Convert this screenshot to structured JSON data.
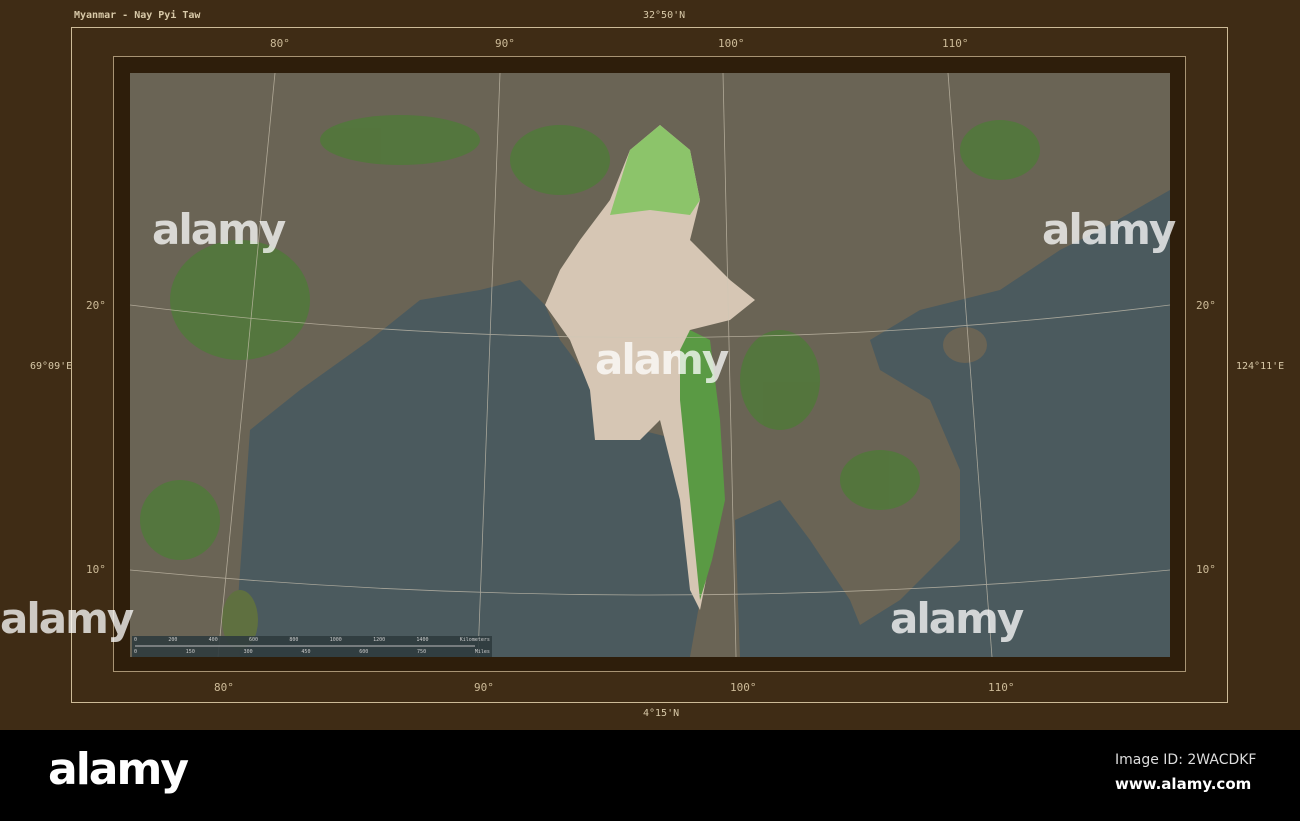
{
  "title": "Myanmar - Nay Pyi Taw",
  "bounds": {
    "north": "32°50'N",
    "south": "4°15'N",
    "west": "69°09'E",
    "east": "124°11'E"
  },
  "lon_ticks": [
    "80°",
    "90°",
    "100°",
    "110°"
  ],
  "lat_ticks": [
    "20°",
    "10°"
  ],
  "scale_bar": {
    "km_labels": [
      "0",
      "200",
      "400",
      "600",
      "800",
      "1000",
      "1200",
      "1400",
      "Kilometers"
    ],
    "mi_labels": [
      "0",
      "150",
      "300",
      "450",
      "600",
      "750",
      "Miles"
    ]
  },
  "watermark": "alamy",
  "footer": {
    "logo": "alamy",
    "image_id": "Image ID: 2WACDKF",
    "site": "www.alamy.com"
  },
  "colors": {
    "sea": "#4b5a5e",
    "land": "#6a6455",
    "highlight": "#d6c6b4",
    "forest": "#4f7a38"
  }
}
